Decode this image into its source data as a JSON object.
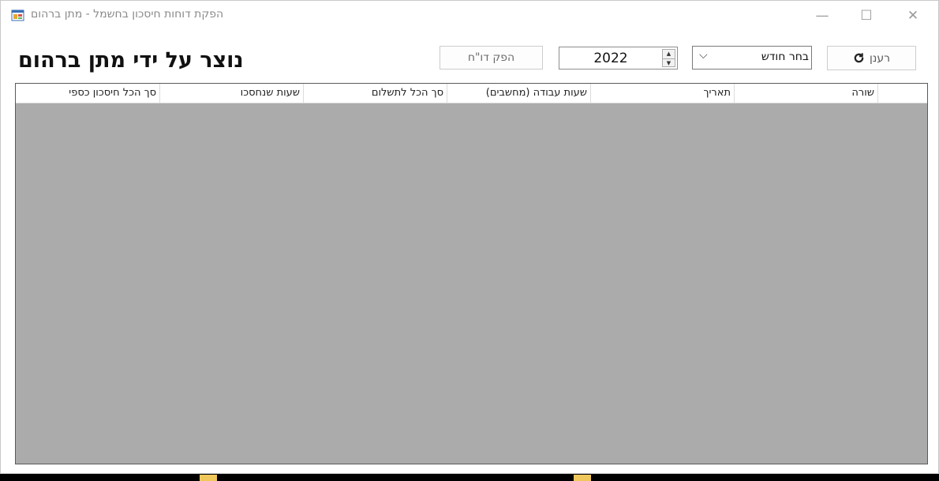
{
  "window": {
    "title": "הפקת דוחות חיסכון בחשמל - מתן ברהום",
    "icon": "app-window-icon",
    "controls": {
      "minimize": "—",
      "maximize": "☐",
      "close": "✕"
    }
  },
  "header": {
    "credit": "נוצר על ידי מתן ברהום"
  },
  "toolbar": {
    "report_button": "הפק דו\"ח",
    "year_value": "2022",
    "month_select": "בחר חודש",
    "refresh_button": "רענן",
    "refresh_icon": "refresh-icon"
  },
  "grid": {
    "columns": [
      "סך הכל חיסכון כספי",
      "שעות שנחסכו",
      "סך הכל לתשלום",
      "שעות עבודה (מחשבים)",
      "תאריך",
      "שורה"
    ]
  }
}
